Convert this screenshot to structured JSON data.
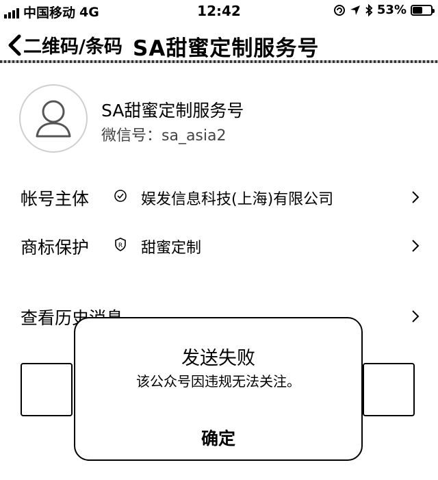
{
  "status_bar": {
    "carrier": "中国移动",
    "network": "4G",
    "time": "12:42",
    "battery": "53%",
    "battery_level": 0.53
  },
  "nav": {
    "back_label": "二维码/条码",
    "title": "SA甜蜜定制服务号"
  },
  "profile": {
    "name": "SA甜蜜定制服务号",
    "wechat_id": "微信号：sa_asia2"
  },
  "rows": [
    {
      "label": "帐号主体",
      "value": "娱发信息科技(上海)有限公司",
      "icon": "verified-check-icon"
    },
    {
      "label": "商标保护",
      "value": "甜蜜定制",
      "icon": "registered-trademark-icon"
    },
    {
      "label": "查看历史消息",
      "value": ""
    }
  ],
  "dialog": {
    "title": "发送失败",
    "message": "该公众号因违规无法关注。",
    "confirm_label": "确定"
  }
}
